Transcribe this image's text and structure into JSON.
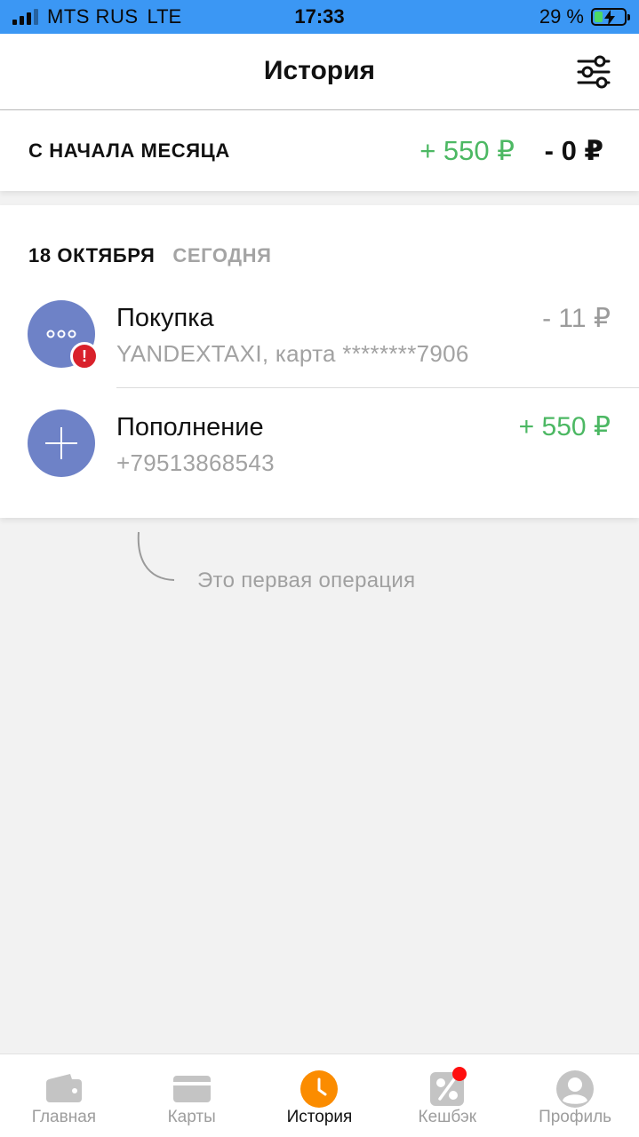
{
  "status_bar": {
    "carrier": "MTS RUS",
    "network": "LTE",
    "time": "17:33",
    "battery": "29 %",
    "battery_level": 0.29
  },
  "header": {
    "title": "История",
    "filter_icon": "sliders-icon"
  },
  "summary": {
    "label": "С НАЧАЛА МЕСЯЦА",
    "income": "+ 550 ₽",
    "expense": "- 0 ₽"
  },
  "operations": {
    "date": "18 ОКТЯБРЯ",
    "date_relative": "СЕГОДНЯ",
    "items": [
      {
        "title": "Покупка",
        "subtitle": "YANDEXTAXI, карта ********7906",
        "amount": "- 11 ₽",
        "icon": "more-dots-icon",
        "badge": "!"
      },
      {
        "title": "Пополнение",
        "subtitle": "+79513868543",
        "amount": "+ 550 ₽",
        "icon": "plus-icon"
      }
    ]
  },
  "hint": {
    "text": "Это первая операция"
  },
  "tabs": [
    {
      "label": "Главная",
      "icon": "wallet-icon"
    },
    {
      "label": "Карты",
      "icon": "card-icon"
    },
    {
      "label": "История",
      "icon": "clock-icon",
      "active": true
    },
    {
      "label": "Кешбэк",
      "icon": "percent-icon",
      "notification": true
    },
    {
      "label": "Профиль",
      "icon": "user-icon"
    }
  ],
  "colors": {
    "status_bar": "#3b97f4",
    "positive": "#4cb863",
    "accent_orange": "#fb8c00",
    "operation_icon": "#6e82c7",
    "error_badge": "#d9212b"
  }
}
